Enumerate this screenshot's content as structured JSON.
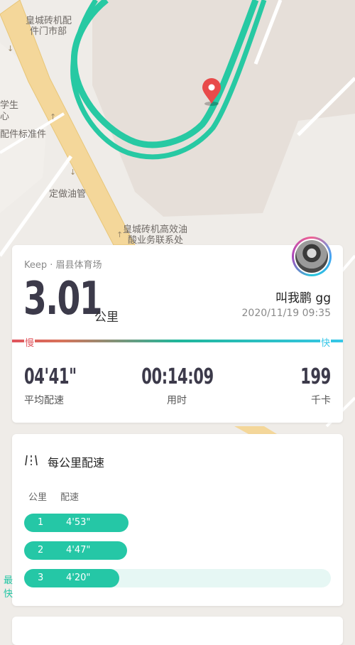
{
  "map": {
    "labels": [
      "皇城砖机配",
      "件门市部",
      "学生",
      "心",
      "配件标准件",
      "定做油管",
      "皇城砖机高效油",
      "酸业务联系处"
    ],
    "route_color": "#27c9a3",
    "marker_color": "#e84a4a"
  },
  "summary": {
    "source": "Keep · 眉县体育场",
    "distance": "3.01",
    "unit": "公里",
    "username": "叫我鹏 gg",
    "datetime": "2020/11/19 09:35",
    "slow_label": "慢",
    "fast_label": "快",
    "stats": [
      {
        "value": "04'41\"",
        "label": "平均配速"
      },
      {
        "value": "00:14:09",
        "label": "用时"
      },
      {
        "value": "199",
        "label": "千卡"
      }
    ]
  },
  "splits": {
    "title": "每公里配速",
    "col_km": "公里",
    "col_pace": "配速",
    "rows": [
      {
        "km": "1",
        "pace": "4'53\"",
        "fraction": 0.34
      },
      {
        "km": "2",
        "pace": "4'47\"",
        "fraction": 0.335
      },
      {
        "km": "3",
        "pace": "4'20\"",
        "fraction": 0.31,
        "best": "最快"
      }
    ]
  },
  "colors": {
    "accent": "#25c7a6",
    "slow": "#e0535c",
    "fast": "#36c7e8",
    "text_dark": "#3c3a4a"
  }
}
